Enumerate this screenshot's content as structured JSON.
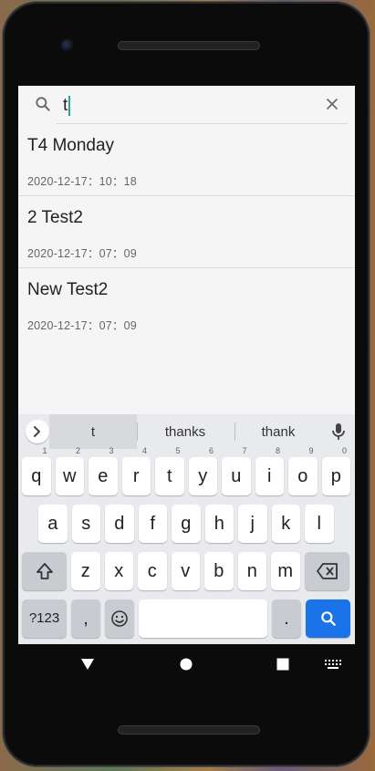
{
  "search": {
    "query": "t"
  },
  "notes": [
    {
      "title": "T4 Monday",
      "date": "2020-12-17：10：18"
    },
    {
      "title": "2 Test2",
      "date": "2020-12-17：07：09"
    },
    {
      "title": "New Test2",
      "date": "2020-12-17：07：09"
    }
  ],
  "keyboard": {
    "suggestions": [
      "t",
      "thanks",
      "thank"
    ],
    "row1": [
      {
        "k": "q",
        "h": "1"
      },
      {
        "k": "w",
        "h": "2"
      },
      {
        "k": "e",
        "h": "3"
      },
      {
        "k": "r",
        "h": "4"
      },
      {
        "k": "t",
        "h": "5"
      },
      {
        "k": "y",
        "h": "6"
      },
      {
        "k": "u",
        "h": "7"
      },
      {
        "k": "i",
        "h": "8"
      },
      {
        "k": "o",
        "h": "9"
      },
      {
        "k": "p",
        "h": "0"
      }
    ],
    "row2": [
      "a",
      "s",
      "d",
      "f",
      "g",
      "h",
      "j",
      "k",
      "l"
    ],
    "row3": [
      "z",
      "x",
      "c",
      "v",
      "b",
      "n",
      "m"
    ],
    "symbols_label": "?123",
    "comma": ",",
    "period": "."
  },
  "icons": {
    "search": "search-icon",
    "clear": "close-icon",
    "expand": "chevron-right-icon",
    "mic": "microphone-icon",
    "shift": "shift-icon",
    "backspace": "backspace-icon",
    "emoji": "emoji-icon",
    "enter": "search-icon",
    "nav_back": "back-triangle-icon",
    "nav_home": "home-circle-icon",
    "nav_recents": "recents-square-icon",
    "nav_keyboard": "keyboard-icon"
  },
  "colors": {
    "accent": "#1a73e8",
    "caret": "#26a69a"
  }
}
